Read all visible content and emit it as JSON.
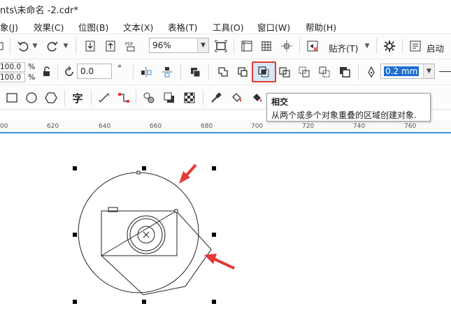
{
  "title": "nts\\未命名 -2.cdr*",
  "menu": [
    {
      "key": "object",
      "label": "象(J)"
    },
    {
      "key": "effects",
      "label": "效果(C)"
    },
    {
      "key": "bitmap",
      "label": "位图(B)"
    },
    {
      "key": "text",
      "label": "文本(X)"
    },
    {
      "key": "table",
      "label": "表格(T)"
    },
    {
      "key": "tools",
      "label": "工具(O)"
    },
    {
      "key": "window",
      "label": "窗口(W)"
    },
    {
      "key": "help",
      "label": "帮助(H)"
    }
  ],
  "toolbar1": {
    "zoom_value": "96%",
    "snap_label": "贴齐(T)",
    "launch_label": "启动"
  },
  "toolbar2": {
    "scale_x": "100.0",
    "scale_y": "100.0",
    "pct_x": "%",
    "pct_y": "%",
    "rotation": "0.0",
    "rotation_unit": "°",
    "outline_width": "0.2 mm"
  },
  "tooltip": {
    "title": "相交",
    "description": "从两个或多个对象重叠的区域创建对象."
  },
  "ruler": {
    "labels": [
      "00",
      "620",
      "640",
      "660",
      "680",
      "700",
      "720",
      "740",
      "760"
    ]
  },
  "toolbar3": {
    "text_tool_label": "字"
  },
  "colors": {
    "accent_blue": "#3a8fd8",
    "highlight_red": "#e53935",
    "arrow_red": "#e53935"
  }
}
